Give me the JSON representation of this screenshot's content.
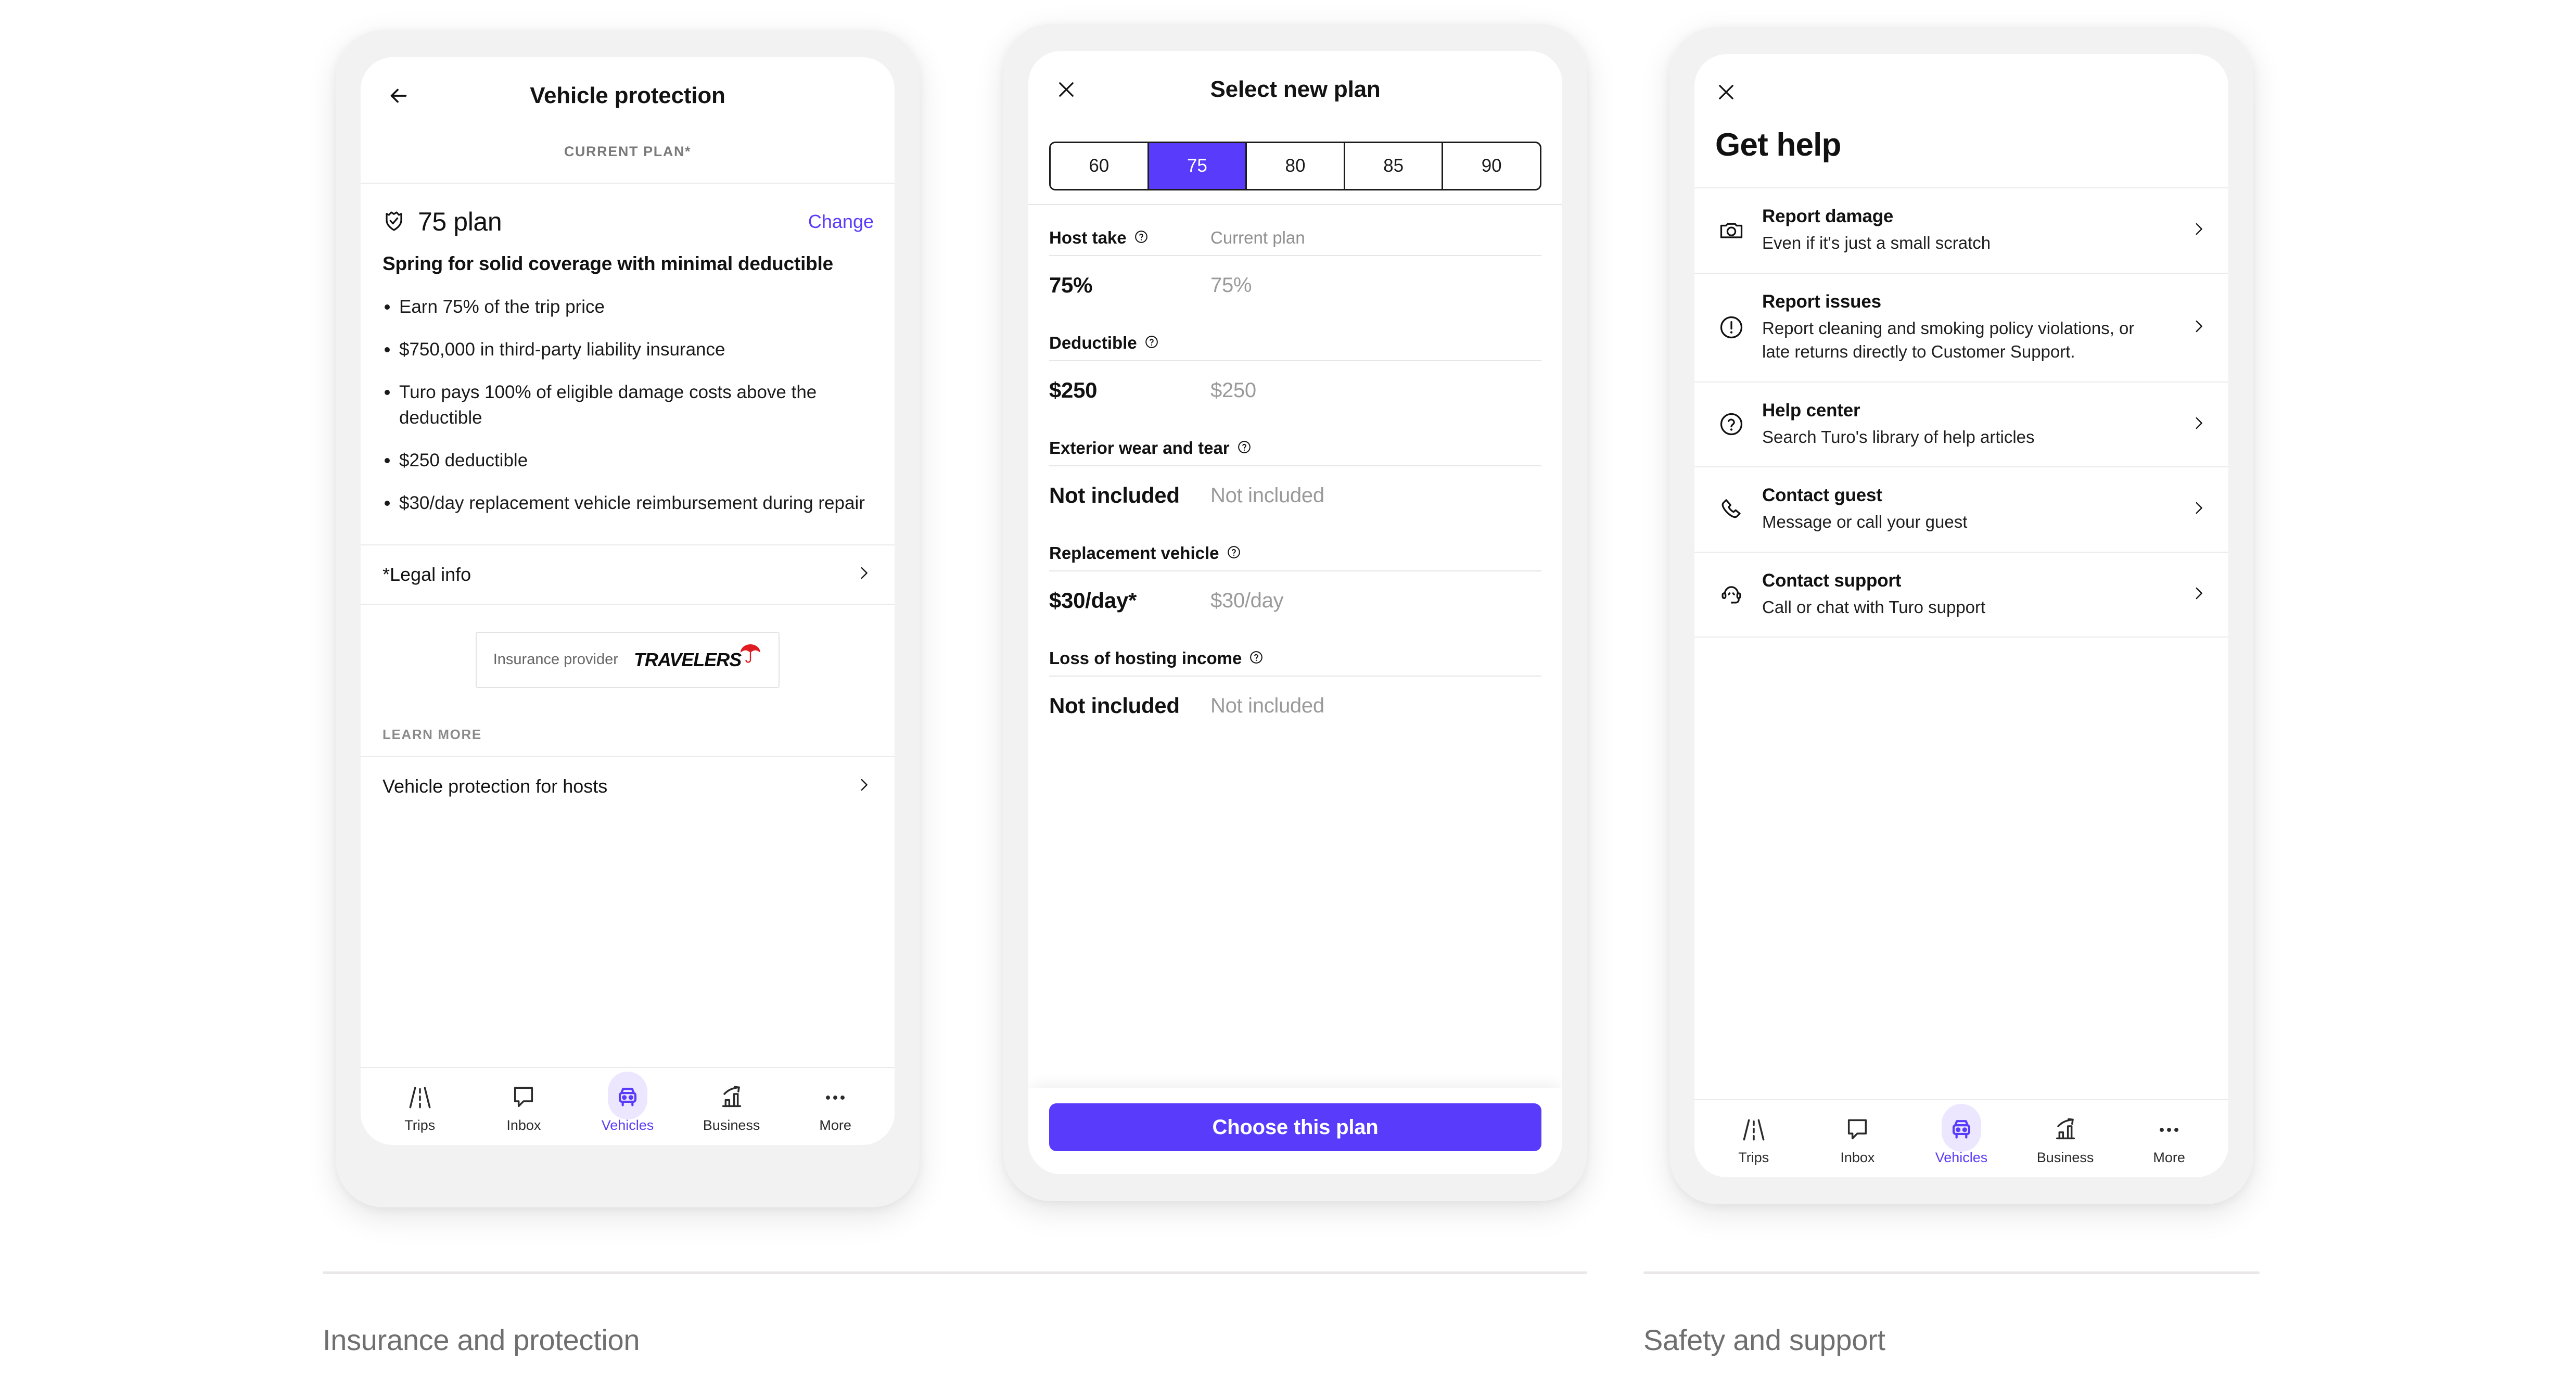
{
  "colors": {
    "accent": "#593cfb",
    "accent_soft": "#ece7ff",
    "frame": "#f2f2f2",
    "muted": "#8e8e8e",
    "travelers_red": "#e01b22"
  },
  "phone1": {
    "header": {
      "title": "Vehicle protection",
      "back_icon": "back-arrow-icon"
    },
    "subheader": "CURRENT PLAN*",
    "plan": {
      "shield_icon": "shield-check-icon",
      "name": "75 plan",
      "change_label": "Change",
      "tagline": "Spring for solid coverage with minimal deductible",
      "bullets": [
        "Earn 75% of the trip price",
        "$750,000 in third-party liability insurance",
        "Turo pays 100% of eligible damage costs above the deductible",
        "$250 deductible",
        "$30/day replacement vehicle reimbursement during repair"
      ]
    },
    "legal_row": {
      "label": "*Legal info",
      "chevron_icon": "chevron-right-icon"
    },
    "provider": {
      "label": "Insurance provider",
      "brand": "TRAVELERS",
      "logo_icon": "umbrella-icon"
    },
    "learn_more_label": "LEARN MORE",
    "learn_more_row": {
      "label": "Vehicle protection for hosts",
      "chevron_icon": "chevron-right-icon"
    },
    "tabs": [
      {
        "label": "Trips",
        "icon": "road-icon",
        "active": false
      },
      {
        "label": "Inbox",
        "icon": "chat-bubble-icon",
        "active": false
      },
      {
        "label": "Vehicles",
        "icon": "car-front-icon",
        "active": true
      },
      {
        "label": "Business",
        "icon": "bar-chart-arrow-icon",
        "active": false
      },
      {
        "label": "More",
        "icon": "ellipsis-icon",
        "active": false
      }
    ]
  },
  "phone2": {
    "header": {
      "title": "Select new plan",
      "close_icon": "close-x-icon"
    },
    "segments": [
      {
        "label": "60",
        "selected": false
      },
      {
        "label": "75",
        "selected": true
      },
      {
        "label": "80",
        "selected": false
      },
      {
        "label": "85",
        "selected": false
      },
      {
        "label": "90",
        "selected": false
      }
    ],
    "current_plan_column_label": "Current plan",
    "rows": [
      {
        "label": "Host take",
        "info_icon": "question-circle-icon",
        "new_value": "75%",
        "current_value": "75%"
      },
      {
        "label": "Deductible",
        "info_icon": "question-circle-icon",
        "new_value": "$250",
        "current_value": "$250"
      },
      {
        "label": "Exterior wear and tear",
        "info_icon": "question-circle-icon",
        "new_value": "Not included",
        "current_value": "Not included"
      },
      {
        "label": "Replacement vehicle",
        "info_icon": "question-circle-icon",
        "new_value": "$30/day*",
        "current_value": "$30/day"
      },
      {
        "label": "Loss of hosting income",
        "info_icon": "question-circle-icon",
        "new_value": "Not included",
        "current_value": "Not included"
      }
    ],
    "cta_label": "Choose this plan"
  },
  "phone3": {
    "header": {
      "close_icon": "close-x-icon"
    },
    "title": "Get help",
    "items": [
      {
        "icon": "camera-icon",
        "title": "Report damage",
        "subtitle": "Even if it's just a small scratch",
        "chevron_icon": "chevron-right-icon"
      },
      {
        "icon": "alert-circle-icon",
        "title": "Report issues",
        "subtitle": "Report cleaning and smoking policy violations, or late returns directly to Customer Support.",
        "chevron_icon": "chevron-right-icon"
      },
      {
        "icon": "question-circle-icon",
        "title": "Help center",
        "subtitle": "Search Turo's library of help articles",
        "chevron_icon": "chevron-right-icon"
      },
      {
        "icon": "phone-icon",
        "title": "Contact guest",
        "subtitle": "Message or call your guest",
        "chevron_icon": "chevron-right-icon"
      },
      {
        "icon": "headset-agent-icon",
        "title": "Contact support",
        "subtitle": "Call or chat with Turo support",
        "chevron_icon": "chevron-right-icon"
      }
    ],
    "tabs": [
      {
        "label": "Trips",
        "icon": "road-icon",
        "active": false
      },
      {
        "label": "Inbox",
        "icon": "chat-bubble-icon",
        "active": false
      },
      {
        "label": "Vehicles",
        "icon": "car-front-icon",
        "active": true
      },
      {
        "label": "Business",
        "icon": "bar-chart-arrow-icon",
        "active": false
      },
      {
        "label": "More",
        "icon": "ellipsis-icon",
        "active": false
      }
    ]
  },
  "captions": {
    "left": "Insurance and protection",
    "right": "Safety and support"
  }
}
